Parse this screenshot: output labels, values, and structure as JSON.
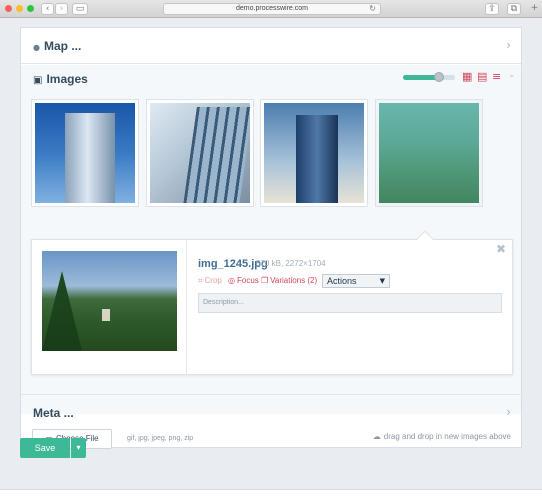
{
  "browser": {
    "url": "demo.processwire.com",
    "back_glyph": "‹",
    "forward_glyph": "›",
    "sidebar_glyph": "▭",
    "reload_glyph": "↻",
    "share_glyph": "⇪",
    "tabs_glyph": "⧉",
    "newtab_glyph": "+"
  },
  "map_section": {
    "icon": "map-pin-icon",
    "glyph": "●",
    "title": "Map ...",
    "chevron": "›"
  },
  "images_section": {
    "icon": "camera-icon",
    "glyph": "▣",
    "title": "Images",
    "thumbnail_size_fraction": 0.7,
    "view_icons": [
      "grid-large-icon",
      "grid-small-icon",
      "list-icon"
    ],
    "view_glyphs": [
      "▦",
      "▤",
      "≡"
    ],
    "chevron": "⌄",
    "accent_color": "#3eb998",
    "view_icon_color": "#d3455b"
  },
  "thumbnails": [
    {
      "alt": "glass skyscraper against blue sky"
    },
    {
      "alt": "window washers on glass building"
    },
    {
      "alt": "tower with clouds"
    },
    {
      "alt": "forest and lighthouse",
      "selected": true
    }
  ],
  "detail": {
    "close": "✖",
    "filename": "img_1245.jpg",
    "meta": "570 kB, 2272×1704",
    "crop_glyph": "⌗",
    "crop": "Crop",
    "focus_glyph": "◎",
    "focus": "Focus",
    "variations_glyph": "❐",
    "variations": "Variations (2)",
    "actions_label": "Actions",
    "caret": "▼",
    "description_placeholder": "Description..."
  },
  "upload": {
    "folder_glyph": "▭",
    "choose_file": "Choose File",
    "extensions": "gif, jpg, jpeg, png, zip",
    "cloud_glyph": "☁",
    "drag_drop": "drag and drop in new images above"
  },
  "meta_section": {
    "title": "Meta ...",
    "chevron": "›"
  },
  "save": {
    "label": "Save",
    "dropdown_glyph": "▾",
    "color": "#3eb998"
  }
}
